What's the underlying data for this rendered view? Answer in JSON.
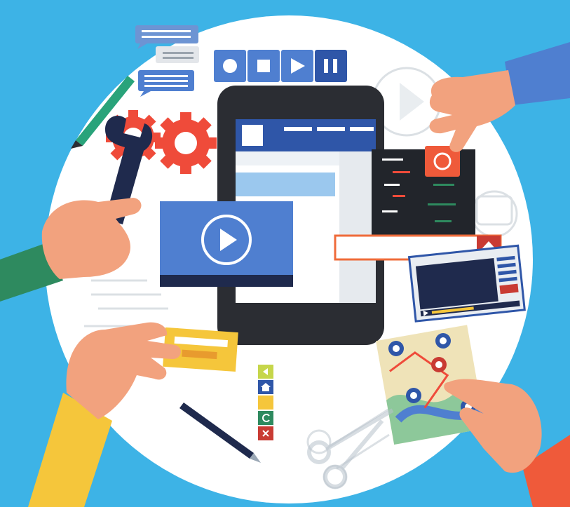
{
  "colors": {
    "background": "#3db3e6",
    "circle": "#ffffff",
    "skin": "#f2a27e",
    "tablet": "#2b2d33",
    "screen_header": "#2f56a8",
    "video": "#4f7fd0",
    "gear": "#ef4b3a",
    "button_red": "#c93b33",
    "search_border": "#ef6b3a",
    "card_yellow": "#f5c63b",
    "map_green": "#8dc89a"
  },
  "icons": [
    "record-icon",
    "stop-icon",
    "play-icon",
    "pause-icon",
    "gear-icon",
    "wrench-icon",
    "pencil-icon",
    "scissors-icon",
    "camera-icon",
    "map-pin-icon",
    "upload-arrow-icon",
    "home-icon",
    "close-icon",
    "refresh-icon",
    "chevron-left-icon"
  ]
}
